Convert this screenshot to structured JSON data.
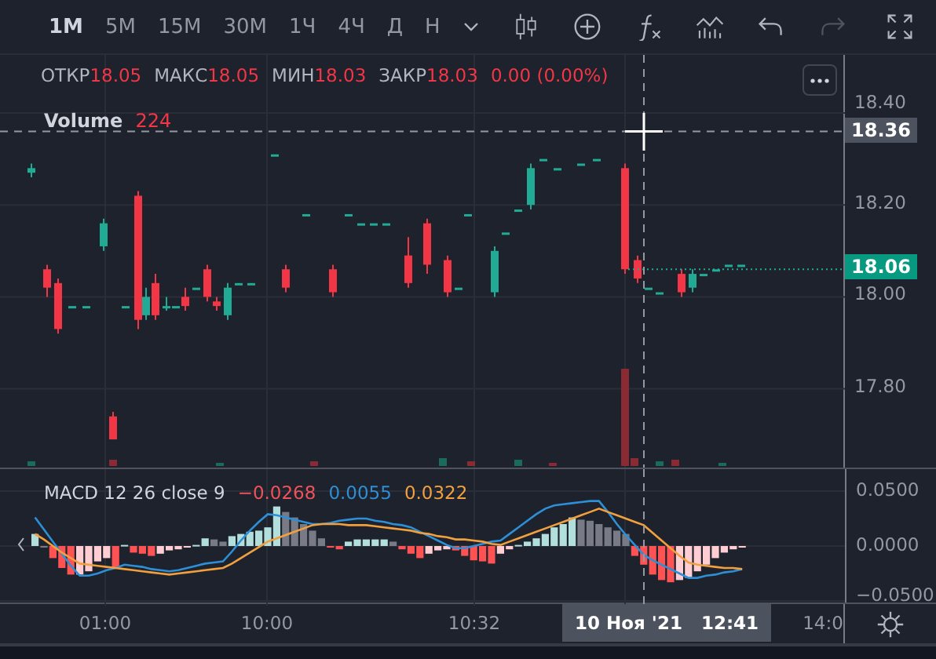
{
  "toolbar": {
    "intervals": [
      {
        "label": "1M",
        "selected": true
      },
      {
        "label": "5M",
        "selected": false
      },
      {
        "label": "15M",
        "selected": false
      },
      {
        "label": "30M",
        "selected": false
      },
      {
        "label": "1Ч",
        "selected": false
      },
      {
        "label": "4Ч",
        "selected": false
      },
      {
        "label": "Д",
        "selected": false
      },
      {
        "label": "Н",
        "selected": false
      }
    ]
  },
  "legend": {
    "items": [
      {
        "label": "ОТКР",
        "value": "18.05"
      },
      {
        "label": "МАКС",
        "value": "18.05"
      },
      {
        "label": "МИН",
        "value": "18.03"
      },
      {
        "label": "ЗАКР",
        "value": "18.03"
      }
    ],
    "change": "0.00 (0.00%)"
  },
  "volume": {
    "label": "Volume",
    "value": "224"
  },
  "price_axis": {
    "ticks": [
      "18.40",
      "18.20",
      "18.00",
      "17.80"
    ],
    "crosshair_price": "18.36",
    "last_price": "18.06"
  },
  "macd": {
    "label": "MACD 12 26 close 9",
    "values": [
      {
        "text": "−0.0268",
        "color": "#f0525a"
      },
      {
        "text": "0.0055",
        "color": "#2d8fd5"
      },
      {
        "text": "0.0322",
        "color": "#f2a03d"
      }
    ],
    "chart_data": {
      "type": "bar",
      "stacked": true,
      "grid": true,
      "ylim": [
        -0.0543,
        0.07
      ],
      "yticks": [
        {
          "value": 0.05,
          "label": "0.0500"
        },
        {
          "value": 0,
          "label": "0.0000"
        },
        {
          "value": -0.05,
          "label": "−0.0500"
        }
      ],
      "series": [
        {
          "color": "#b2dfdb",
          "values": [
            0.011,
            null,
            null,
            null,
            null,
            null,
            null,
            null,
            null,
            null,
            0.001,
            null,
            null,
            null,
            null,
            null,
            null,
            null,
            0.001,
            0.007,
            null,
            null,
            0.009,
            0.011,
            0.013,
            0.014,
            0.017,
            0.036,
            null,
            null,
            null,
            null,
            null,
            null,
            null,
            0.004,
            0.006,
            0.006,
            0.006,
            0.006,
            null,
            null,
            null,
            null,
            null,
            null,
            null,
            null,
            null,
            null,
            null,
            null,
            null,
            null,
            0.001,
            0.004,
            0.007,
            0.011,
            0.017,
            0.02,
            0.026,
            null,
            null,
            null,
            null,
            null,
            null,
            null,
            null,
            null,
            null,
            null,
            null,
            null,
            null,
            null,
            null,
            null,
            null,
            null
          ]
        },
        {
          "color": "#787b86",
          "values": [
            null,
            0,
            null,
            null,
            null,
            null,
            null,
            null,
            null,
            null,
            null,
            null,
            null,
            null,
            null,
            null,
            null,
            null,
            null,
            null,
            0.006,
            0.004,
            null,
            null,
            null,
            null,
            null,
            null,
            0.031,
            0.026,
            0.02,
            0.014,
            0.007,
            null,
            null,
            null,
            null,
            null,
            null,
            null,
            0.004,
            null,
            null,
            null,
            null,
            null,
            null,
            null,
            null,
            null,
            null,
            null,
            null,
            null,
            null,
            null,
            null,
            null,
            null,
            null,
            null,
            0.024,
            0.023,
            0.02,
            0.017,
            0.014,
            0.011,
            null,
            null,
            null,
            null,
            null,
            null,
            null,
            null,
            null,
            null,
            null,
            null,
            null
          ]
        },
        {
          "color": "#ff5252",
          "values": [
            null,
            null,
            -0.011,
            -0.02,
            -0.026,
            null,
            null,
            null,
            null,
            -0.02,
            null,
            -0.006,
            -0.007,
            -0.009,
            null,
            null,
            null,
            null,
            null,
            null,
            null,
            null,
            null,
            null,
            null,
            null,
            null,
            null,
            null,
            null,
            null,
            null,
            null,
            -0.001,
            -0.003,
            null,
            null,
            null,
            null,
            null,
            null,
            -0.003,
            -0.007,
            -0.011,
            null,
            null,
            null,
            -0.004,
            -0.009,
            -0.013,
            -0.014,
            -0.016,
            null,
            null,
            null,
            null,
            null,
            null,
            null,
            null,
            null,
            null,
            null,
            null,
            null,
            null,
            null,
            -0.009,
            -0.017,
            -0.026,
            -0.031,
            -0.033,
            null,
            null,
            null,
            null,
            null,
            null,
            null,
            null
          ]
        },
        {
          "color": "#ffcdd2",
          "values": [
            null,
            null,
            null,
            null,
            null,
            -0.026,
            -0.023,
            -0.014,
            -0.011,
            null,
            null,
            null,
            null,
            null,
            -0.007,
            -0.004,
            -0.003,
            -0.001,
            null,
            null,
            null,
            null,
            null,
            null,
            null,
            null,
            null,
            null,
            null,
            null,
            null,
            null,
            null,
            null,
            null,
            null,
            null,
            null,
            null,
            null,
            null,
            null,
            null,
            null,
            -0.007,
            -0.004,
            -0.003,
            null,
            null,
            null,
            null,
            null,
            -0.007,
            -0.003,
            null,
            null,
            null,
            null,
            null,
            null,
            null,
            null,
            null,
            null,
            null,
            null,
            null,
            null,
            null,
            null,
            null,
            null,
            -0.031,
            -0.029,
            -0.023,
            -0.017,
            -0.011,
            -0.006,
            -0.003,
            -0.001
          ]
        },
        {
          "type": "line",
          "color": "#2d8fd5",
          "values": [
            0.026,
            0.015,
            0.004,
            -0.007,
            -0.018,
            -0.027,
            -0.027,
            -0.025,
            -0.022,
            -0.02,
            -0.017,
            -0.018,
            -0.019,
            -0.021,
            -0.022,
            -0.023,
            -0.022,
            -0.02,
            -0.018,
            -0.016,
            -0.015,
            -0.014,
            -0.005,
            0.005,
            0.014,
            0.022,
            0.029,
            0.028,
            0.026,
            0.024,
            0.022,
            0.02,
            0.02,
            0.021,
            0.023,
            0.024,
            0.025,
            0.025,
            0.023,
            0.022,
            0.02,
            0.019,
            0.017,
            0.013,
            0.009,
            0.005,
            0.001,
            -0.002,
            -0.002,
            0,
            0.002,
            0.004,
            0.005,
            0.011,
            0.017,
            0.023,
            0.029,
            0.034,
            0.037,
            0.038,
            0.039,
            0.04,
            0.041,
            0.041,
            0.031,
            0.02,
            0.01,
            0.001,
            -0.008,
            -0.013,
            -0.017,
            -0.021,
            -0.025,
            -0.029,
            -0.029,
            -0.027,
            -0.026,
            -0.024,
            -0.023,
            -0.021
          ]
        },
        {
          "type": "line",
          "color": "#f2a03d",
          "values": [
            0.011,
            0.006,
            0,
            -0.006,
            -0.011,
            -0.016,
            -0.017,
            -0.018,
            -0.019,
            -0.02,
            -0.021,
            -0.022,
            -0.023,
            -0.024,
            -0.025,
            -0.026,
            -0.025,
            -0.024,
            -0.023,
            -0.022,
            -0.021,
            -0.02,
            -0.016,
            -0.011,
            -0.006,
            -0.001,
            0.004,
            0.007,
            0.01,
            0.013,
            0.016,
            0.019,
            0.02,
            0.02,
            0.02,
            0.019,
            0.019,
            0.019,
            0.018,
            0.017,
            0.016,
            0.015,
            0.014,
            0.012,
            0.011,
            0.009,
            0.008,
            0.006,
            0.006,
            0.005,
            0.004,
            0.002,
            0.001,
            0.004,
            0.007,
            0.01,
            0.013,
            0.016,
            0.019,
            0.022,
            0.025,
            0.028,
            0.031,
            0.034,
            0.031,
            0.028,
            0.025,
            0.022,
            0.019,
            0.012,
            0.005,
            -0.002,
            -0.009,
            -0.015,
            -0.017,
            -0.018,
            -0.019,
            -0.02,
            -0.02,
            -0.021
          ]
        }
      ]
    }
  },
  "time_axis": {
    "ticks": [
      "01:00",
      "10:00",
      "10:32",
      "14:0"
    ],
    "crosshair_date": "10 Ноя '21",
    "crosshair_time": "12:41"
  }
}
